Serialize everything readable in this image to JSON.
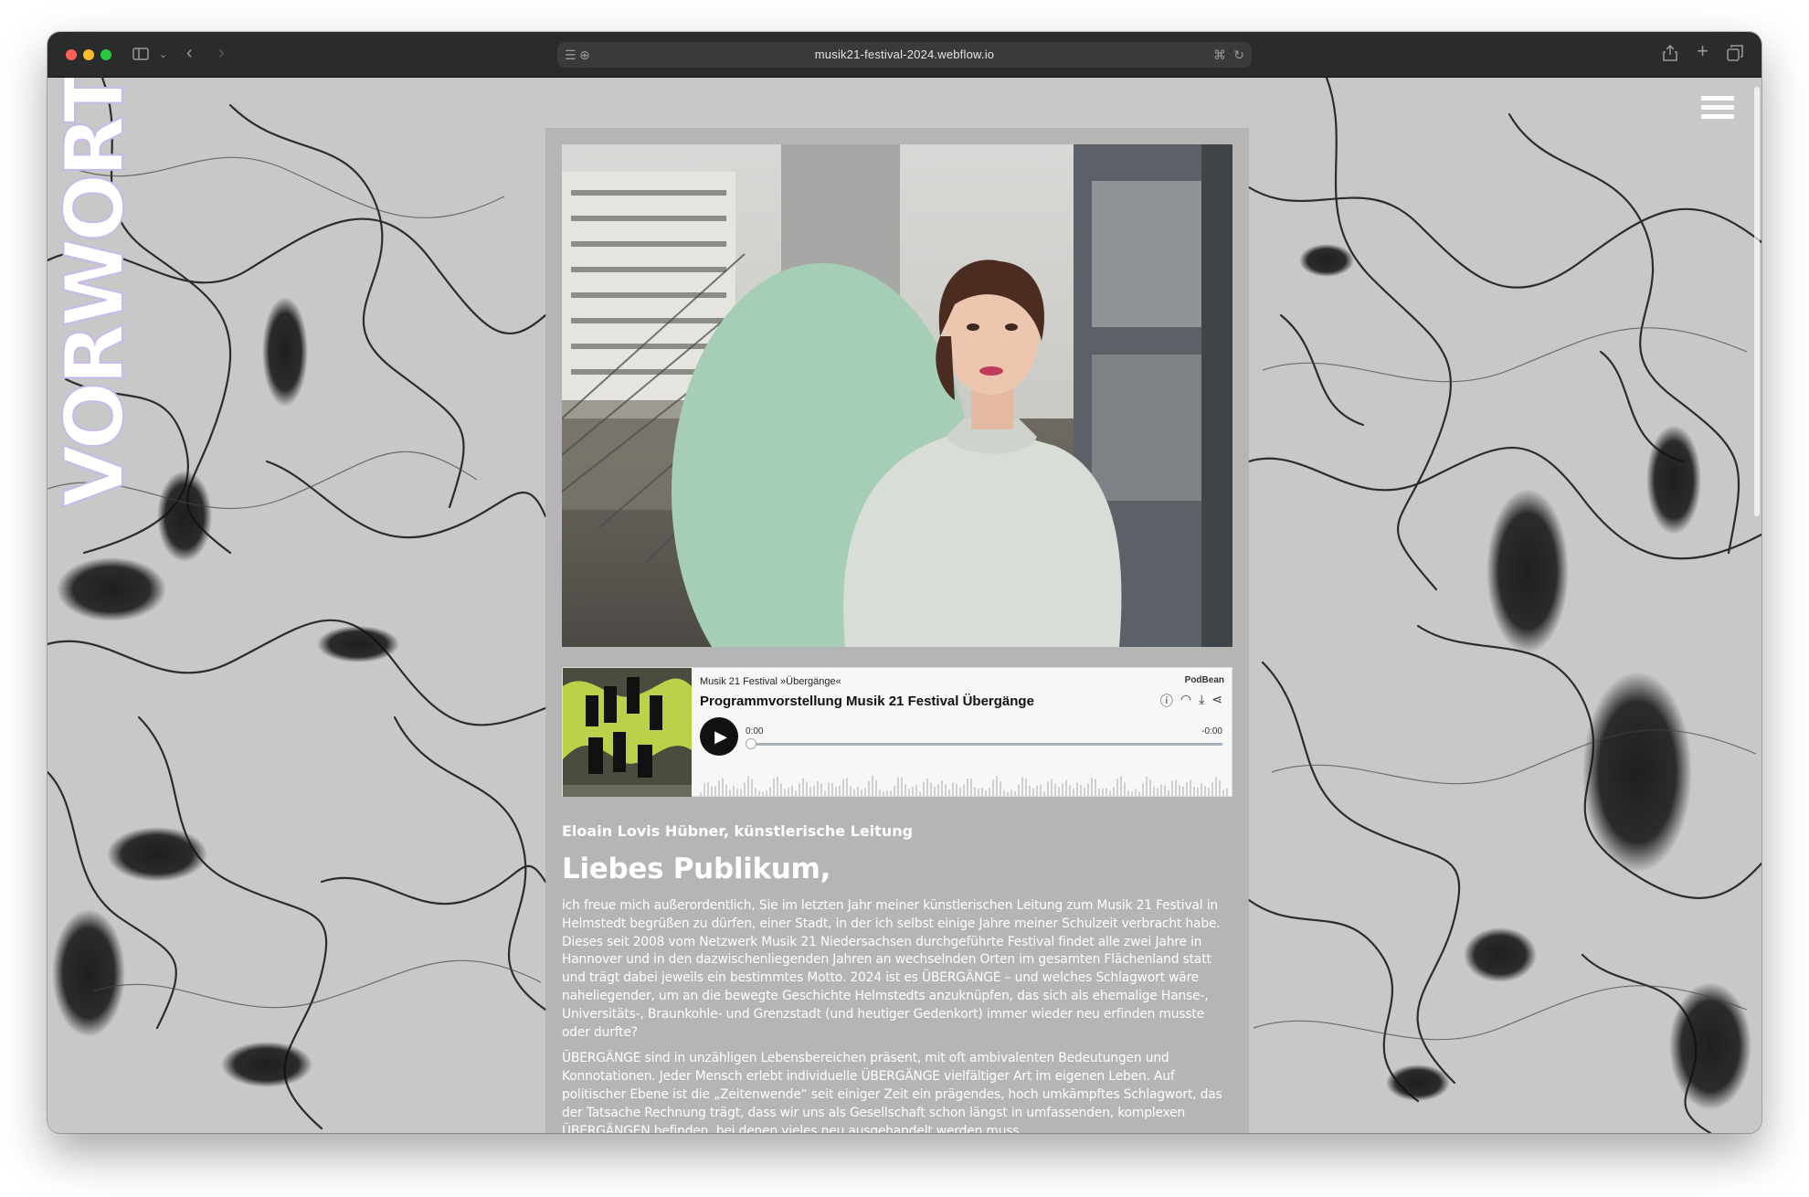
{
  "browser": {
    "url": "musik21-festival-2024.webflow.io"
  },
  "site": {
    "logo_text": "VORWORT"
  },
  "podcast": {
    "show": "Musik 21 Festival »Übergänge«",
    "episode_title": "Programmvorstellung Musik 21 Festival Übergänge",
    "brand": "PodBean",
    "time_start": "0:00",
    "time_end": "-0:00",
    "progress": 0
  },
  "article": {
    "author": "Eloain Lovis Hübner, künstlerische Leitung",
    "greeting": "Liebes Publikum,",
    "paragraphs": [
      "ich freue mich außerordentlich, Sie im letzten Jahr meiner künstlerischen Leitung zum Musik 21 Festival in Helmstedt begrüßen zu dürfen, einer Stadt, in der ich selbst einige Jahre meiner Schulzeit verbracht habe. Dieses seit 2008 vom Netzwerk Musik 21 Niedersachsen durchgeführte Festival findet alle zwei Jahre in Hannover und in den dazwischenliegenden Jahren an wechselnden Orten im gesamten Flächenland statt und trägt dabei jeweils ein bestimmtes Motto. 2024 ist es ÜBERGÄNGE – und welches Schlagwort wäre naheliegender, um an die bewegte Geschichte Helmstedts anzuknüpfen, das sich als ehemalige Hanse-, Universitäts-, Braunkohle- und Grenzstadt (und heutiger Gedenkort) immer wieder neu erfinden musste oder durfte?",
      "ÜBERGÄNGE sind in unzähligen Lebensbereichen präsent, mit oft ambivalenten Bedeutungen und Konnotationen. Jeder Mensch erlebt individuelle ÜBERGÄNGE vielfältiger Art im eigenen Leben. Auf politischer Ebene ist die „Zeitenwende“ seit einiger Zeit ein prägendes, hoch umkämpftes Schlagwort, das der Tatsache Rechnung trägt, dass wir uns als Gesellschaft schon längst in umfassenden, komplexen ÜBERGÄNGEN befinden, bei denen vieles neu ausgehandelt werden muss."
    ]
  }
}
